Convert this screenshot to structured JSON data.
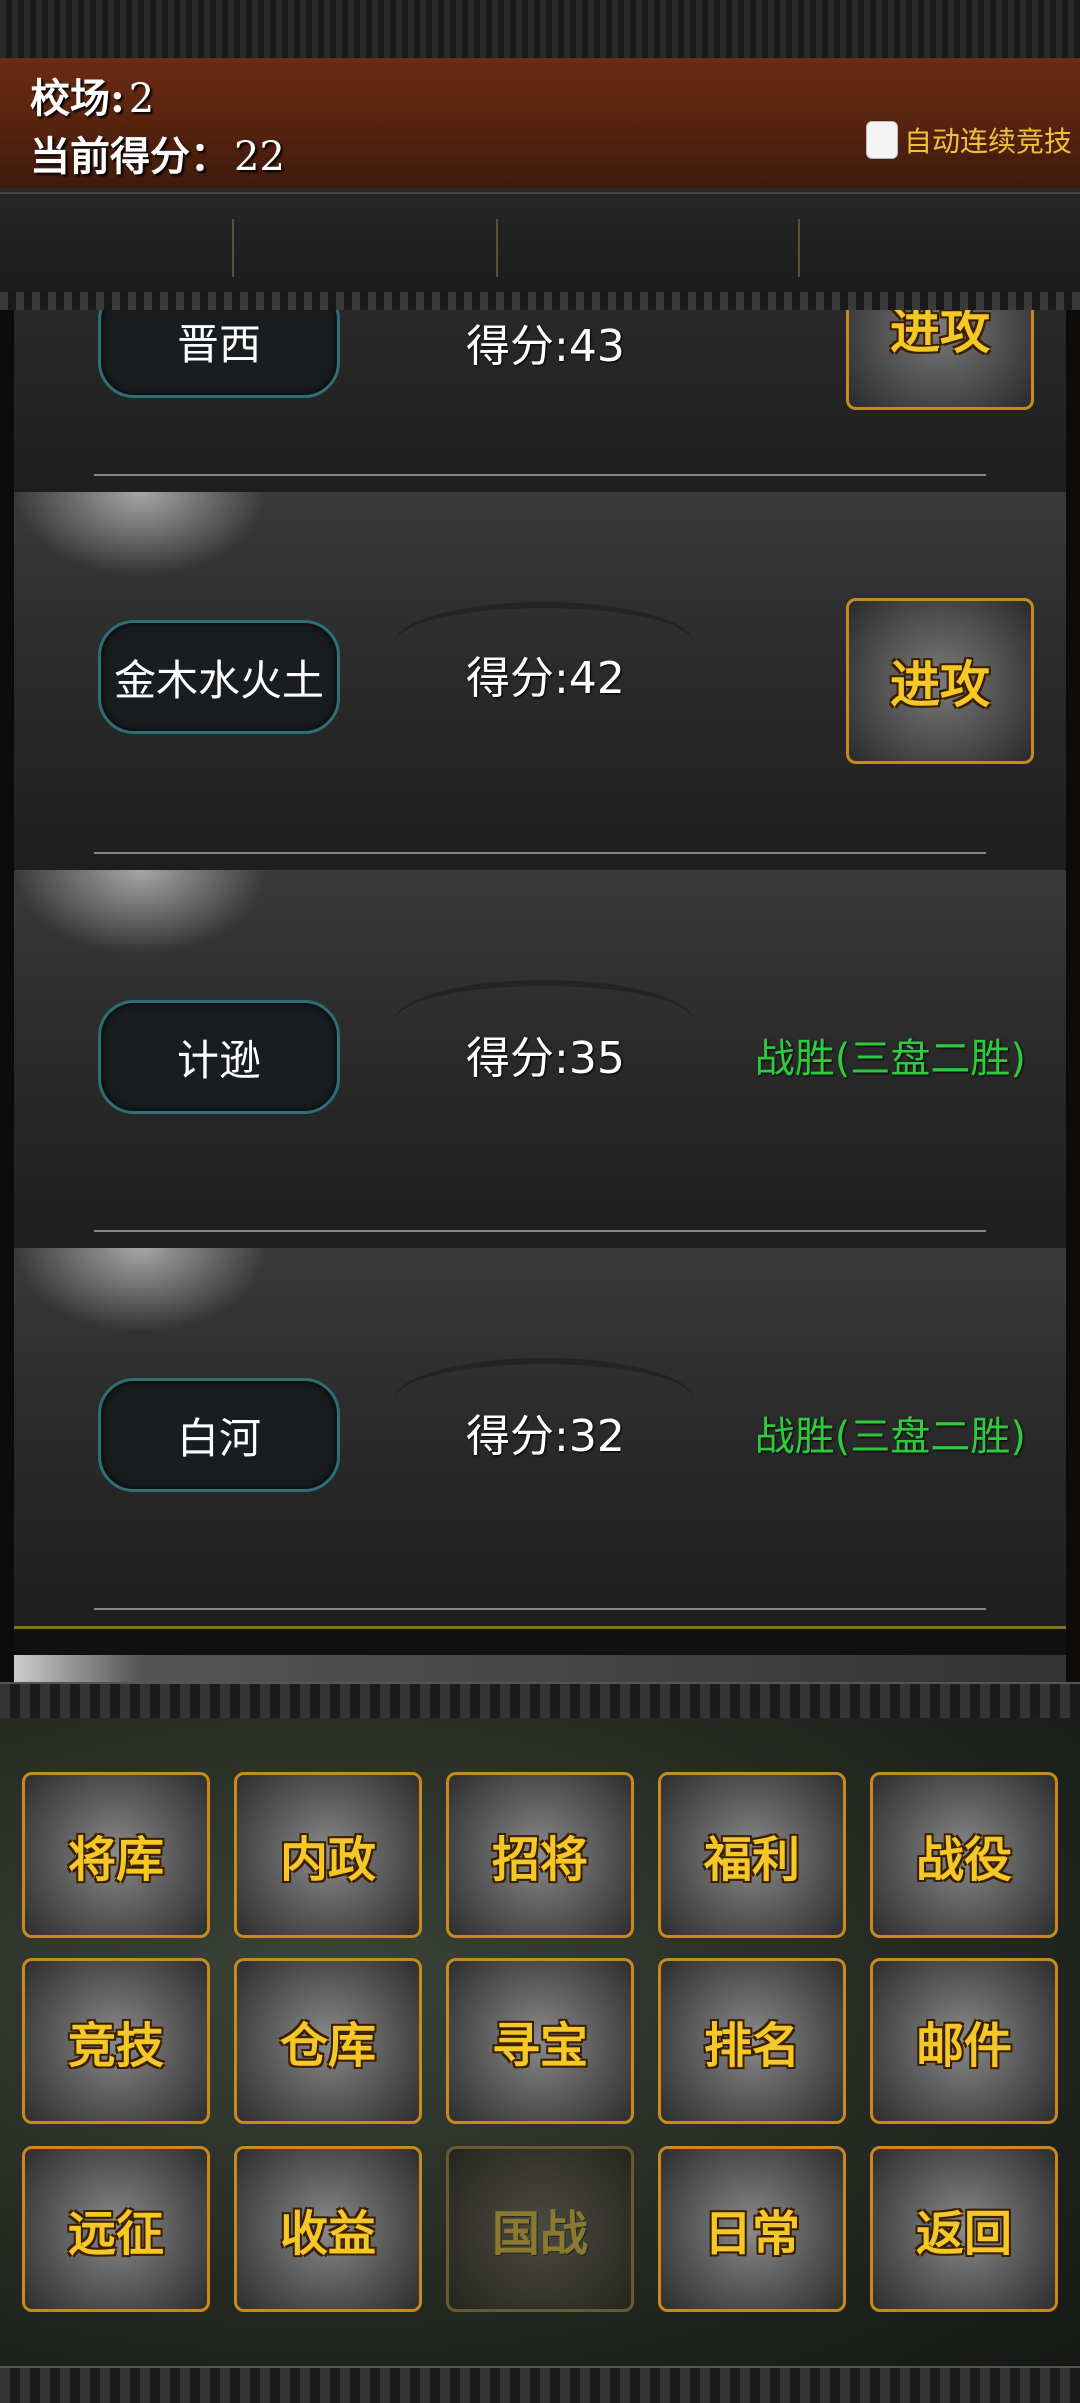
{
  "header": {
    "arena_label": "校场:",
    "arena_value": "2",
    "score_label": "当前得分：",
    "score_value": "22",
    "auto_label": "自动连续竞技",
    "auto_checked": false
  },
  "rows": [
    {
      "name": "晋西",
      "score": "得分:43",
      "action": "进攻",
      "result": ""
    },
    {
      "name": "金木水火土",
      "score": "得分:42",
      "action": "进攻",
      "result": ""
    },
    {
      "name": "计逊",
      "score": "得分:35",
      "action": "",
      "result": "战胜(三盘二胜)"
    },
    {
      "name": "白河",
      "score": "得分:32",
      "action": "",
      "result": "战胜(三盘二胜)"
    }
  ],
  "menu": {
    "items": [
      {
        "label": "将库",
        "enabled": true
      },
      {
        "label": "内政",
        "enabled": true
      },
      {
        "label": "招将",
        "enabled": true
      },
      {
        "label": "福利",
        "enabled": true
      },
      {
        "label": "战役",
        "enabled": true
      },
      {
        "label": "竞技",
        "enabled": true
      },
      {
        "label": "仓库",
        "enabled": true
      },
      {
        "label": "寻宝",
        "enabled": true
      },
      {
        "label": "排名",
        "enabled": true
      },
      {
        "label": "邮件",
        "enabled": true
      },
      {
        "label": "远征",
        "enabled": true
      },
      {
        "label": "收益",
        "enabled": true
      },
      {
        "label": "国战",
        "enabled": false
      },
      {
        "label": "日常",
        "enabled": true
      },
      {
        "label": "返回",
        "enabled": true
      }
    ]
  },
  "colors": {
    "header_bg": "#5a2410",
    "accent_gold": "#f5c826",
    "result_green": "#2ecb3e",
    "button_border": "#c88a1e"
  }
}
